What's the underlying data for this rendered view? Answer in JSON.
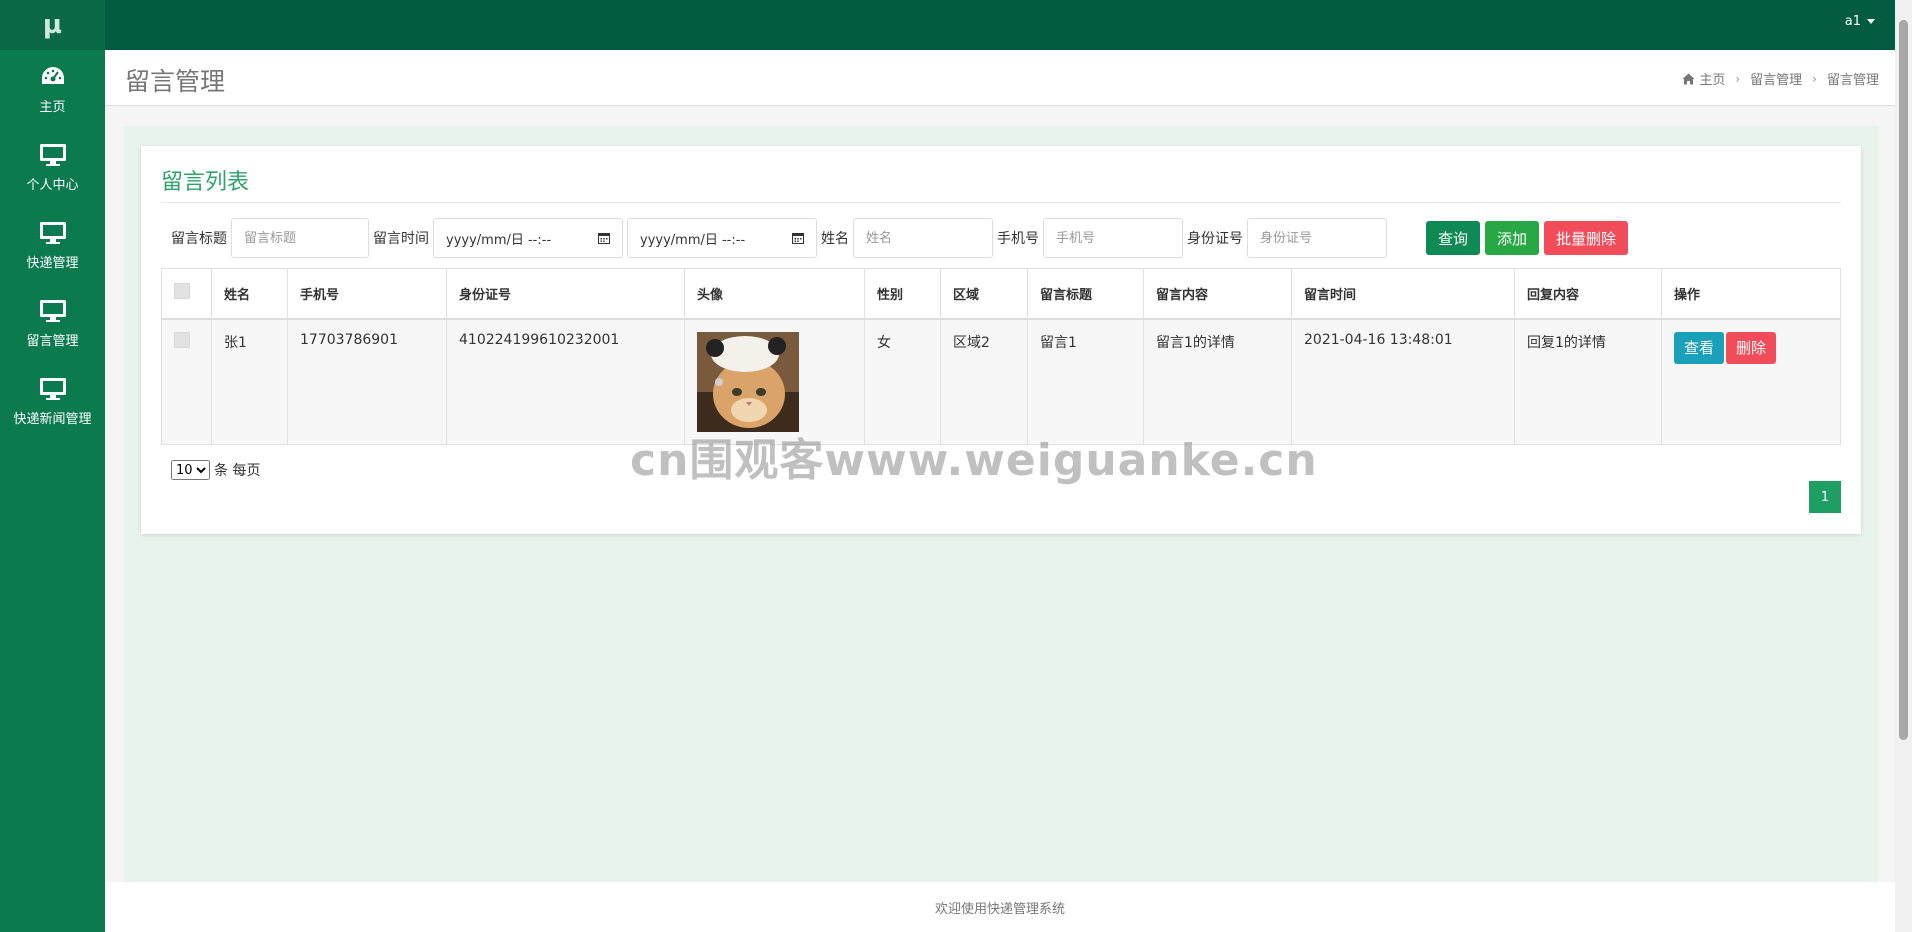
{
  "app": {
    "logo_text": "µ",
    "user_name": "a1"
  },
  "sidebar": {
    "items": [
      {
        "label": "主页",
        "icon": "dashboard-icon"
      },
      {
        "label": "个人中心",
        "icon": "monitor-icon"
      },
      {
        "label": "快递管理",
        "icon": "monitor-icon"
      },
      {
        "label": "留言管理",
        "icon": "monitor-icon"
      },
      {
        "label": "快递新闻管理",
        "icon": "monitor-icon"
      }
    ]
  },
  "header": {
    "title": "留言管理",
    "breadcrumb": [
      "主页",
      "留言管理",
      "留言管理"
    ]
  },
  "card": {
    "title": "留言列表"
  },
  "search": {
    "title_label": "留言标题",
    "title_placeholder": "留言标题",
    "time_label": "留言时间",
    "date_start": "yyyy/mm/日 --:--",
    "date_end": "yyyy/mm/日 --:--",
    "name_label": "姓名",
    "name_placeholder": "姓名",
    "phone_label": "手机号",
    "phone_placeholder": "手机号",
    "idcard_label": "身份证号",
    "idcard_placeholder": "身份证号",
    "query_button": "查询",
    "add_button": "添加",
    "batch_delete_button": "批量删除"
  },
  "table": {
    "headers": [
      "姓名",
      "手机号",
      "身份证号",
      "头像",
      "性别",
      "区域",
      "留言标题",
      "留言内容",
      "留言时间",
      "回复内容",
      "操作"
    ],
    "rows": [
      {
        "name": "张1",
        "phone": "17703786901",
        "idcard": "410224199610232001",
        "gender": "女",
        "region": "区域2",
        "title": "留言1",
        "content": "留言1的详情",
        "time": "2021-04-16 13:48:01",
        "reply": "回复1的详情",
        "view_label": "查看",
        "delete_label": "删除"
      }
    ]
  },
  "pagination": {
    "page_size": "10",
    "page_size_suffix": "条 每页",
    "current_page": "1"
  },
  "watermark": "cn围观客www.weiguanke.cn",
  "footer": {
    "text": "欢迎使用快递管理系统"
  },
  "colors": {
    "sidebar": "#0b7b4f",
    "topbar": "#035c41",
    "accent": "#2ea36b",
    "danger": "#f14c5a",
    "info": "#1aa0b8"
  }
}
